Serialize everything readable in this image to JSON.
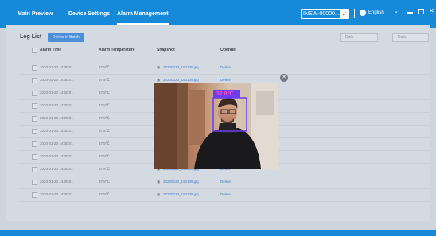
{
  "nav": {
    "tabs": [
      "Main Preview",
      "Device Settings",
      "Alarm Management"
    ],
    "device": "INEW-00000...",
    "confirm_icon": "check-icon",
    "language": "English"
  },
  "log": {
    "title": "Log List",
    "delete_label": "Delete in Batch",
    "start_placeholder": "Date",
    "end_placeholder": "Date"
  },
  "table": {
    "headers": [
      "Alarm Time",
      "Alarm Temperature",
      "Snapshot",
      "Operate"
    ],
    "rows": [
      {
        "time": "2020-01-20 14:30:01",
        "temp": "37.8℃",
        "snapshot": "20200220_153109.jpg",
        "op": "Delete"
      },
      {
        "time": "2020-01-20 14:30:01",
        "temp": "37.8℃",
        "snapshot": "20200220_153109.jpg",
        "op": "Delete"
      },
      {
        "time": "2020-01-20 14:30:01",
        "temp": "37.8℃",
        "snapshot": "",
        "op": ""
      },
      {
        "time": "2020-01-20 14:30:01",
        "temp": "37.8℃",
        "snapshot": "",
        "op": ""
      },
      {
        "time": "2020-01-20 14:30:01",
        "temp": "37.8℃",
        "snapshot": "",
        "op": ""
      },
      {
        "time": "2020-01-20 14:30:01",
        "temp": "37.8℃",
        "snapshot": "",
        "op": ""
      },
      {
        "time": "2020-01-20 14:30:01",
        "temp": "37.8℃",
        "snapshot": "",
        "op": ""
      },
      {
        "time": "2020-01-20 14:30:01",
        "temp": "37.8℃",
        "snapshot": "",
        "op": ""
      },
      {
        "time": "2020-01-20 14:30:01",
        "temp": "37.8℃",
        "snapshot": "20200220_153109.jpg",
        "op": "Delete"
      },
      {
        "time": "2020-01-20 14:30:01",
        "temp": "37.8℃",
        "snapshot": "20200220_153109.jpg",
        "op": "Delete"
      },
      {
        "time": "2020-01-20 14:30:01",
        "temp": "37.8℃",
        "snapshot": "20200220_153109.jpg",
        "op": "Delete"
      }
    ]
  },
  "preview": {
    "temperature_label": "37.8℃",
    "close_icon": "close-icon"
  },
  "colors": {
    "brand": "#1789d9",
    "link": "#4a80c8",
    "face_box": "#6a3df0"
  }
}
